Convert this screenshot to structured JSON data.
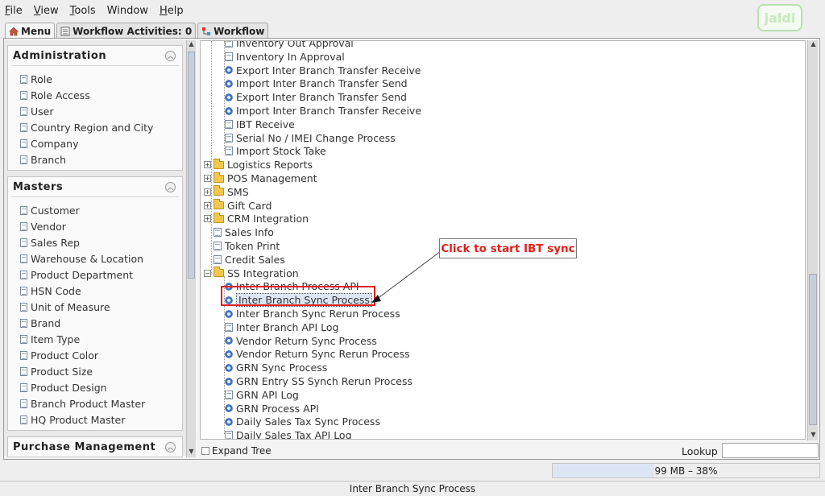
{
  "menubar": {
    "items": [
      {
        "label": "File",
        "mnemonic": "F",
        "rest": "ile"
      },
      {
        "label": "View",
        "mnemonic": "V",
        "rest": "iew"
      },
      {
        "label": "Tools",
        "mnemonic": "T",
        "rest": "ools"
      },
      {
        "label": "Window",
        "mnemonic": "",
        "rest": "Window"
      },
      {
        "label": "Help",
        "mnemonic": "H",
        "rest": "elp"
      }
    ],
    "logo": "jaldi"
  },
  "tabs": {
    "menu": "Menu",
    "workflow_activities": "Workflow Activities: 0",
    "workflow": "Workflow"
  },
  "left": {
    "administration": {
      "title": "Administration",
      "items": [
        "Role",
        "Role Access",
        "User",
        "Country Region and City",
        "Company",
        "Branch"
      ]
    },
    "masters": {
      "title": "Masters",
      "items": [
        "Customer",
        "Vendor",
        "Sales Rep",
        "Warehouse & Location",
        "Product Department",
        "HSN Code",
        "Unit of Measure",
        "Brand",
        "Item Type",
        "Product Color",
        "Product Size",
        "Product Design",
        "Branch Product Master",
        "HQ Product Master"
      ]
    },
    "purchase": {
      "title": "Purchase Management"
    }
  },
  "tree": {
    "rows": [
      {
        "label": "Inventory Out Approval",
        "icon": "page",
        "level": 2
      },
      {
        "label": "Inventory In Approval",
        "icon": "page",
        "level": 2
      },
      {
        "label": "Export Inter Branch Transfer Receive",
        "icon": "gear",
        "level": 2
      },
      {
        "label": "Import Inter Branch Transfer Send",
        "icon": "gear",
        "level": 2
      },
      {
        "label": "Export Inter Branch Transfer Send",
        "icon": "gear",
        "level": 2
      },
      {
        "label": "Import Inter Branch Transfer Receive",
        "icon": "gear",
        "level": 2
      },
      {
        "label": "IBT Receive",
        "icon": "page",
        "level": 2
      },
      {
        "label": "Serial No / IMEI Change Process",
        "icon": "page",
        "level": 2
      },
      {
        "label": "Import Stock Take",
        "icon": "page",
        "level": 2
      },
      {
        "label": "Logistics Reports",
        "icon": "folder",
        "level": 1
      },
      {
        "label": "POS Management",
        "icon": "folder",
        "level": 1
      },
      {
        "label": "SMS",
        "icon": "folder",
        "level": 1
      },
      {
        "label": "Gift Card",
        "icon": "folder",
        "level": 1
      },
      {
        "label": "CRM Integration",
        "icon": "folder",
        "level": 1
      },
      {
        "label": "Sales Info",
        "icon": "page",
        "level": 1
      },
      {
        "label": "Token Print",
        "icon": "page",
        "level": 1
      },
      {
        "label": "Credit Sales",
        "icon": "page",
        "level": 1
      },
      {
        "label": "SS Integration",
        "icon": "folder-open",
        "level": 1
      },
      {
        "label": "Inter Branch Process API",
        "icon": "gear",
        "level": 2
      },
      {
        "label": "Inter Branch Sync Process",
        "icon": "gear",
        "level": 2,
        "selected": true
      },
      {
        "label": "Inter Branch Sync Rerun Process",
        "icon": "gear",
        "level": 2
      },
      {
        "label": "Inter Branch API Log",
        "icon": "page",
        "level": 2
      },
      {
        "label": "Vendor Return Sync Process",
        "icon": "gear",
        "level": 2
      },
      {
        "label": "Vendor Return Sync Rerun Process",
        "icon": "gear",
        "level": 2
      },
      {
        "label": "GRN Sync Process",
        "icon": "gear",
        "level": 2
      },
      {
        "label": "GRN Entry SS Synch Rerun Process",
        "icon": "gear",
        "level": 2
      },
      {
        "label": "GRN API Log",
        "icon": "page",
        "level": 2
      },
      {
        "label": "GRN Process API",
        "icon": "gear",
        "level": 2
      },
      {
        "label": "Daily Sales Tax Sync Process",
        "icon": "gear",
        "level": 2
      },
      {
        "label": "Daily Sales Tax API Log",
        "icon": "page",
        "level": 2
      }
    ],
    "callout": "Click to start IBT sync",
    "expand_tree": "Expand Tree",
    "lookup": "Lookup"
  },
  "memory": {
    "text": "99 MB – 38%",
    "percent": 38
  },
  "status": {
    "text": "Inter Branch Sync Process"
  },
  "colors": {
    "accent_red": "#e0201a",
    "selection": "#dde6f5"
  }
}
